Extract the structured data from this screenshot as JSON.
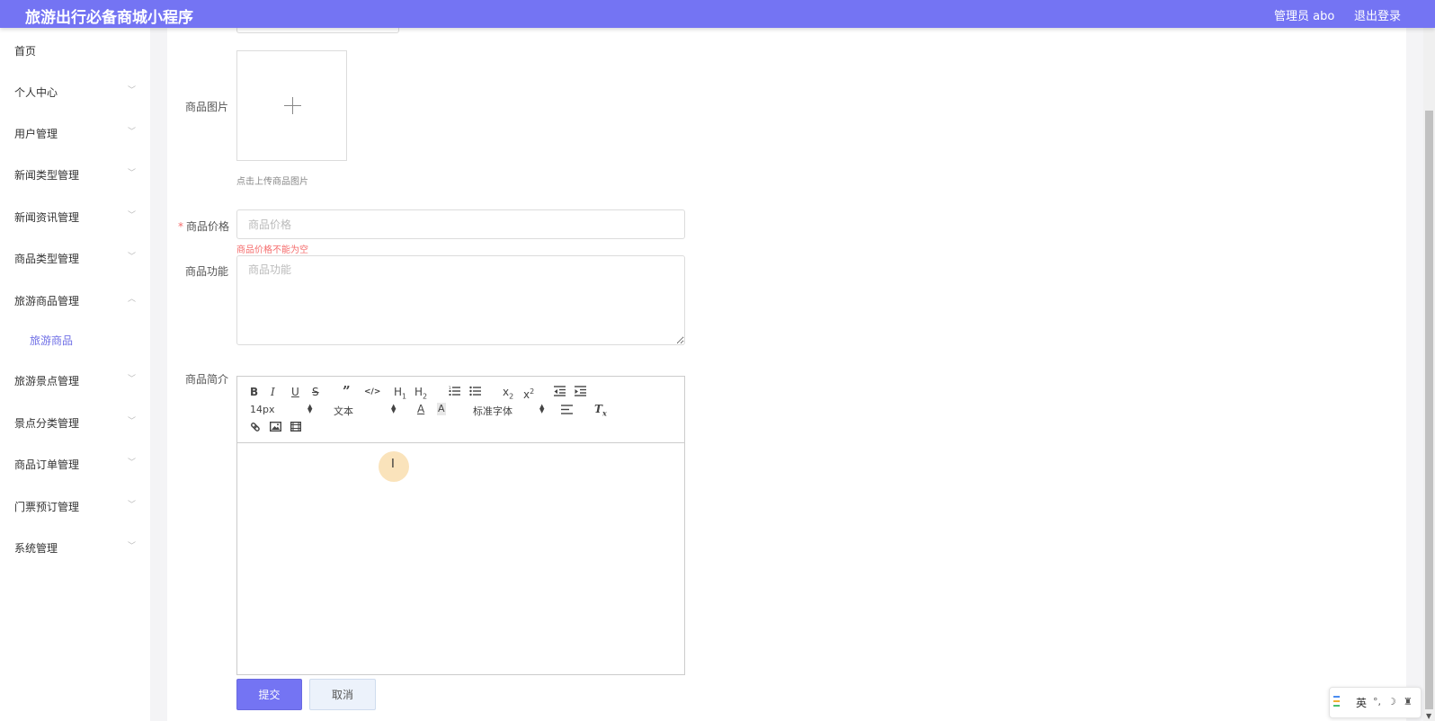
{
  "header": {
    "title": "旅游出行必备商城小程序",
    "admin_label": "管理员 abo",
    "logout_label": "退出登录"
  },
  "sidebar": {
    "items": [
      {
        "label": "首页"
      },
      {
        "label": "个人中心"
      },
      {
        "label": "用户管理"
      },
      {
        "label": "新闻类型管理"
      },
      {
        "label": "新闻资讯管理"
      },
      {
        "label": "商品类型管理"
      },
      {
        "label": "旅游商品管理"
      },
      {
        "label": "旅游景点管理"
      },
      {
        "label": "景点分类管理"
      },
      {
        "label": "商品订单管理"
      },
      {
        "label": "门票预订管理"
      },
      {
        "label": "系统管理"
      }
    ],
    "submenu": {
      "label": "旅游商品"
    }
  },
  "form": {
    "image": {
      "label": "商品图片",
      "tip": "点击上传商品图片"
    },
    "price": {
      "label": "商品价格",
      "placeholder": "商品价格",
      "error": "商品价格不能为空"
    },
    "function": {
      "label": "商品功能",
      "placeholder": "商品功能"
    },
    "intro": {
      "label": "商品简介"
    }
  },
  "editor": {
    "font_size": "14px",
    "heading": "文本",
    "font_family": "标准字体"
  },
  "buttons": {
    "submit": "提交",
    "cancel": "取消"
  },
  "ime": {
    "lang": "英"
  },
  "colors": {
    "primary": "#7474f3",
    "error": "#f56c6c"
  }
}
